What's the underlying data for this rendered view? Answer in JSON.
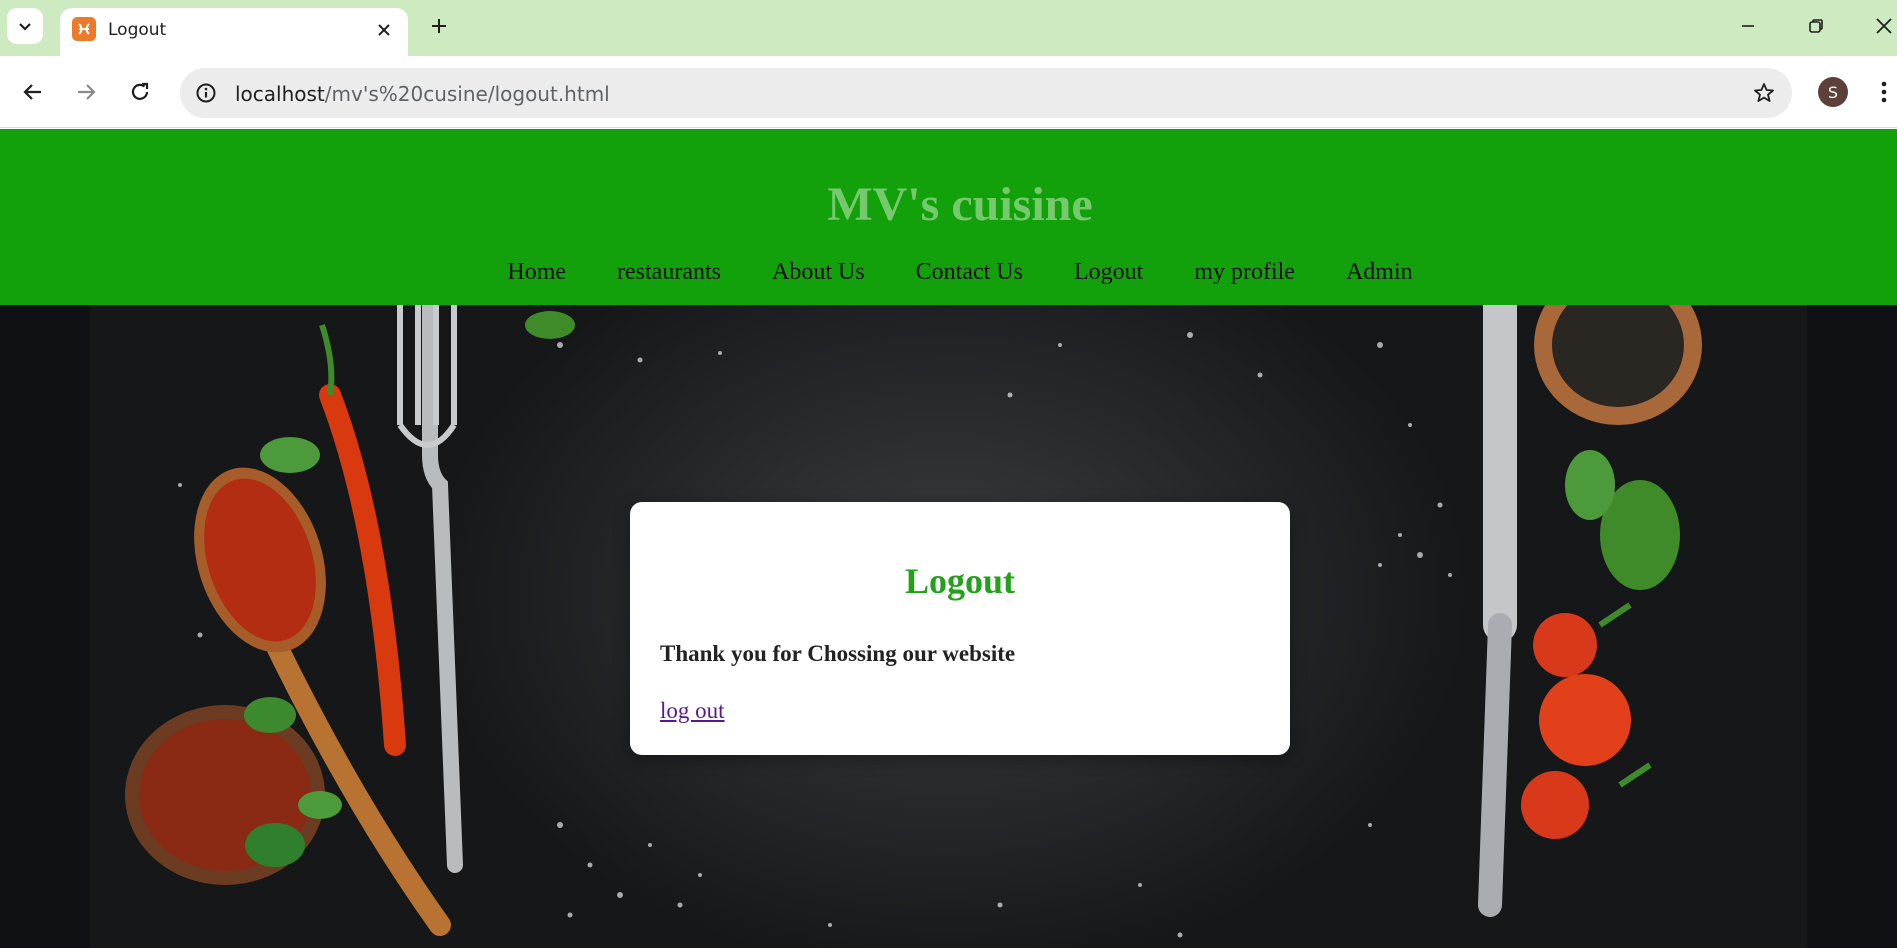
{
  "browser": {
    "tab": {
      "title": "Logout"
    },
    "url": {
      "host": "localhost",
      "path": "/mv's%20cusine/logout.html"
    },
    "profile_initial": "S"
  },
  "site": {
    "brand": "MV's cuisine",
    "nav": [
      "Home",
      "restaurants",
      "About Us",
      "Contact Us",
      "Logout",
      "my profile",
      "Admin"
    ]
  },
  "card": {
    "title": "Logout",
    "message": "Thank you for Chossing our website",
    "link": "log out"
  },
  "colors": {
    "header_bg": "#12a10a",
    "brand_text": "#77c96e",
    "card_title": "#23a11b",
    "visited_link": "#551a8b"
  },
  "icons": {
    "tab_favicon": "xampp-icon",
    "tab_close": "close-icon",
    "new_tab": "plus-icon",
    "back": "arrow-left-icon",
    "forward": "arrow-right-icon",
    "reload": "reload-icon",
    "site_info": "info-icon",
    "bookmark": "star-icon",
    "menu": "more-vertical-icon"
  }
}
